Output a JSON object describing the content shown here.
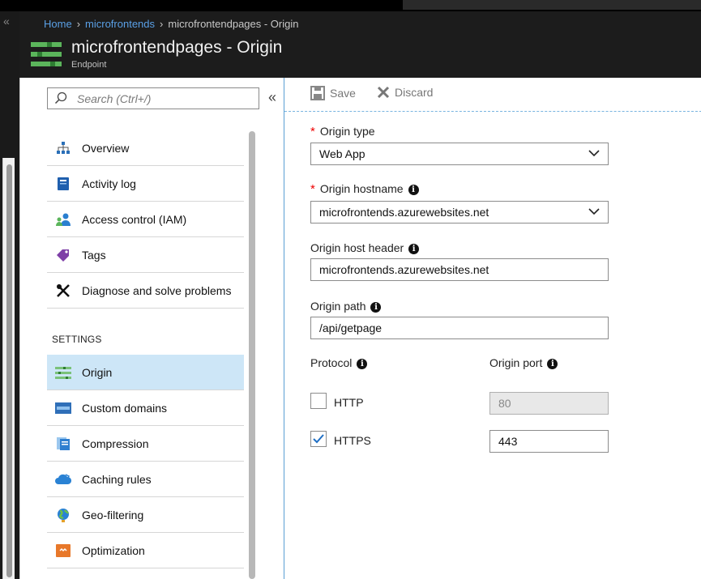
{
  "breadcrumb": {
    "home": "Home",
    "parent": "microfrontends",
    "current": "microfrontendpages - Origin"
  },
  "header": {
    "title": "microfrontendpages - Origin",
    "subtitle": "Endpoint"
  },
  "nav": {
    "search_placeholder": "Search (Ctrl+/)",
    "collapse_glyph": "«",
    "items": [
      {
        "label": "Overview",
        "icon": "overview-icon"
      },
      {
        "label": "Activity log",
        "icon": "activity-log-icon"
      },
      {
        "label": "Access control (IAM)",
        "icon": "access-control-icon"
      },
      {
        "label": "Tags",
        "icon": "tag-icon"
      },
      {
        "label": "Diagnose and solve problems",
        "icon": "wrench-icon"
      }
    ],
    "section": "SETTINGS",
    "settings": [
      {
        "label": "Origin",
        "icon": "origin-icon",
        "active": true
      },
      {
        "label": "Custom domains",
        "icon": "custom-domains-icon"
      },
      {
        "label": "Compression",
        "icon": "compression-icon"
      },
      {
        "label": "Caching rules",
        "icon": "cloud-icon"
      },
      {
        "label": "Geo-filtering",
        "icon": "globe-icon"
      },
      {
        "label": "Optimization",
        "icon": "optimization-icon"
      }
    ]
  },
  "toolbar": {
    "save": "Save",
    "discard": "Discard"
  },
  "form": {
    "origin_type": {
      "label": "Origin type",
      "value": "Web App"
    },
    "origin_hostname": {
      "label": "Origin hostname",
      "value": "microfrontends.azurewebsites.net"
    },
    "host_header": {
      "label": "Origin host header",
      "value": "microfrontends.azurewebsites.net"
    },
    "origin_path": {
      "label": "Origin path",
      "value": "/api/getpage"
    },
    "protocol_label": "Protocol",
    "port_label": "Origin port",
    "http": {
      "label": "HTTP",
      "checked": false,
      "port": "80"
    },
    "https": {
      "label": "HTTPS",
      "checked": true,
      "port": "443"
    }
  },
  "colors": {
    "accent": "#5aa0e6",
    "active_bg": "#cde6f7",
    "required": "#e00000"
  }
}
